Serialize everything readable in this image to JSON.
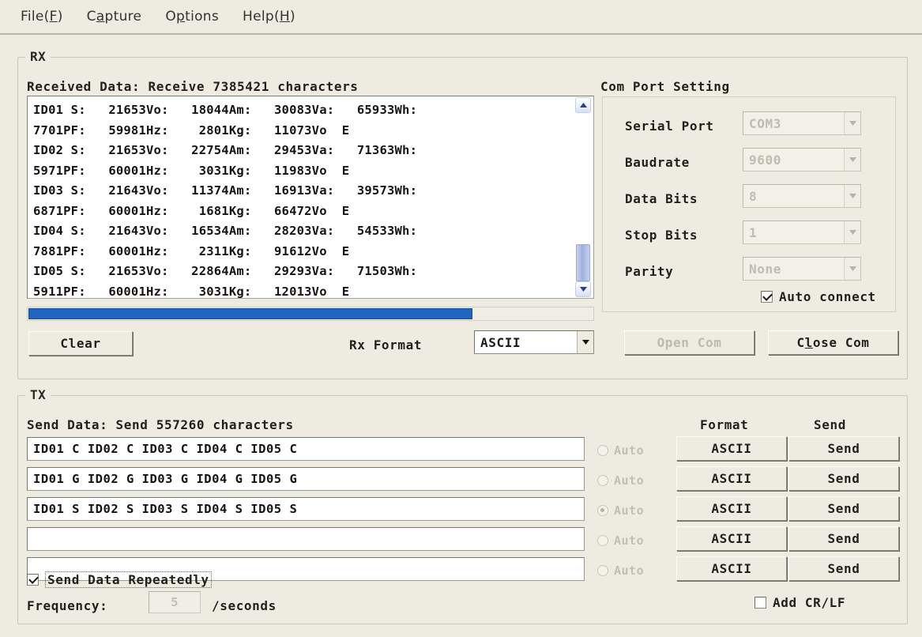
{
  "menu": {
    "items": [
      {
        "pre": "File(",
        "accel": "F",
        "post": ")"
      },
      {
        "pre": "C",
        "accel": "a",
        "post": "pture"
      },
      {
        "pre": "O",
        "accel": "p",
        "post": "tions"
      },
      {
        "pre": "Help(",
        "accel": "H",
        "post": ")"
      }
    ],
    "labels": [
      "File(F)",
      "Capture",
      "Options",
      "Help(H)"
    ]
  },
  "rx": {
    "group_title": "RX",
    "received_label": "Received Data: Receive 7385421 characters",
    "received_count": 7385421,
    "lines": [
      "ID01 S:   21653Vo:   18044Am:   30083Va:   65933Wh:",
      "7701PF:   59981Hz:    2801Kg:   11073Vo  E",
      "ID02 S:   21653Vo:   22754Am:   29453Va:   71363Wh:",
      "5971PF:   60001Hz:    3031Kg:   11983Vo  E",
      "ID03 S:   21643Vo:   11374Am:   16913Va:   39573Wh:",
      "6871PF:   60001Hz:    1681Kg:   66472Vo  E",
      "ID04 S:   21643Vo:   16534Am:   28203Va:   54533Wh:",
      "7881PF:   60001Hz:    2311Kg:   91612Vo  E",
      "ID05 S:   21653Vo:   22864Am:   29293Va:   71503Wh:",
      "5911PF:   60001Hz:    3031Kg:   12013Vo  E"
    ],
    "clear_button": "Clear",
    "rx_format_label": "Rx Format",
    "rx_format_value": "ASCII",
    "rx_format_options": [
      "ASCII"
    ]
  },
  "com_port": {
    "group_title": "Com Port Setting",
    "fields": [
      {
        "label": "Serial Port",
        "value": "COM3",
        "disabled": true
      },
      {
        "label": "Baudrate",
        "value": "9600",
        "disabled": true
      },
      {
        "label": "Data Bits",
        "value": "8",
        "disabled": true
      },
      {
        "label": "Stop Bits",
        "value": "1",
        "disabled": true
      },
      {
        "label": "Parity",
        "value": "None",
        "disabled": true
      }
    ],
    "auto_connect": {
      "label": "Auto connect",
      "checked": true
    },
    "open_button": {
      "label": "Open Com",
      "disabled": true
    },
    "close_button": {
      "pre": "C",
      "accel": "l",
      "post": "ose Com",
      "label": "Close Com",
      "disabled": false
    }
  },
  "tx": {
    "group_title": "TX",
    "send_label": "Send Data: Send 557260 characters",
    "send_count": 557260,
    "col_format": "Format",
    "col_send": "Send",
    "rows": [
      {
        "value": "ID01 C ID02 C ID03 C ID04 C ID05 C",
        "auto_label": "Auto",
        "auto_selected": false,
        "format": "ASCII",
        "send": "Send"
      },
      {
        "value": "ID01 G ID02 G ID03 G ID04 G ID05 G",
        "auto_label": "Auto",
        "auto_selected": false,
        "format": "ASCII",
        "send": "Send"
      },
      {
        "value": "ID01 S ID02 S ID03 S ID04 S ID05 S",
        "auto_label": "Auto",
        "auto_selected": true,
        "format": "ASCII",
        "send": "Send"
      },
      {
        "value": "",
        "auto_label": "Auto",
        "auto_selected": false,
        "format": "ASCII",
        "send": "Send"
      },
      {
        "value": "",
        "auto_label": "Auto",
        "auto_selected": false,
        "format": "ASCII",
        "send": "Send"
      }
    ],
    "repeat": {
      "label": "Send Data Repeatedly",
      "checked": true
    },
    "frequency_label": "Frequency:",
    "frequency_value": "5",
    "frequency_unit": "/seconds",
    "add_crlf": {
      "label": "Add CR/LF",
      "checked": false
    }
  },
  "colors": {
    "window_bg": "#eeece1",
    "accent_blue": "#2064c0",
    "text": "#231f1b",
    "disabled_text": "#bdbaae"
  }
}
